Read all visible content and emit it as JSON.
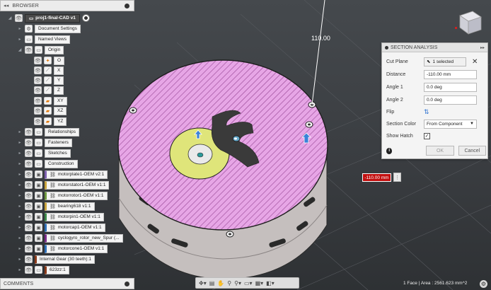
{
  "browser": {
    "title": "BROWSER",
    "collapse_icon": "double-chevron-left-icon",
    "root_label": "proj1-final-CAD v1",
    "items": [
      {
        "label": "Document Settings",
        "icon": "gear-icon"
      },
      {
        "label": "Named Views",
        "icon": "folder-icon"
      },
      {
        "label": "Origin",
        "icon": "folder-icon"
      },
      {
        "label": "O",
        "icon": "origin-point-icon"
      },
      {
        "label": "X",
        "icon": "axis-icon"
      },
      {
        "label": "Y",
        "icon": "axis-icon"
      },
      {
        "label": "Z",
        "icon": "axis-icon"
      },
      {
        "label": "XY",
        "icon": "plane-icon"
      },
      {
        "label": "XZ",
        "icon": "plane-icon"
      },
      {
        "label": "YZ",
        "icon": "plane-icon"
      },
      {
        "label": "Relationships",
        "icon": "folder-icon"
      },
      {
        "label": "Fasteners",
        "icon": "folder-icon"
      },
      {
        "label": "Sketches",
        "icon": "folder-icon"
      },
      {
        "label": "Construction",
        "icon": "folder-icon"
      }
    ],
    "components": [
      {
        "label": "motorplate1-OEM v2:1",
        "color": "#7e5fb0"
      },
      {
        "label": "motorstator1-OEM v1:1",
        "color": "#c9a33a"
      },
      {
        "label": "motorrotor1-OEM v1:1",
        "color": "#6f9a3e"
      },
      {
        "label": "bearing618 v1:1",
        "color": "#c9a33a"
      },
      {
        "label": "motorpin1-OEM v1:1",
        "color": "#3d8a4a"
      },
      {
        "label": "motorcap1-OEM v1:1",
        "color": "#2e6fb8"
      },
      {
        "label": "cyclogyro_rotor_new_Spur (...",
        "color": "#7a2a8a"
      },
      {
        "label": "motorcone1-OEM v1:1",
        "color": "#2e6fb8"
      }
    ],
    "tail_items": [
      {
        "label": "Internal Gear (30 teeth):1",
        "color": "#8a3a1a"
      },
      {
        "label": "623zz:1",
        "color": "#8a3a1a"
      }
    ]
  },
  "comments": {
    "title": "COMMENTS"
  },
  "viewport": {
    "dimension_label": "110.00",
    "distance_input": "-110.00 mm",
    "status_text": "1 Face | Area : 2561.623 mm^2"
  },
  "section_analysis": {
    "title": "SECTION ANALYSIS",
    "rows": {
      "cut_plane_label": "Cut Plane",
      "cut_plane_value": "1 selected",
      "distance_label": "Distance",
      "distance_value": "-110.00 mm",
      "angle1_label": "Angle 1",
      "angle1_value": "0.0 deg",
      "angle2_label": "Angle 2",
      "angle2_value": "0.0 deg",
      "flip_label": "Flip",
      "section_color_label": "Section Color",
      "section_color_value": "From Component",
      "show_hatch_label": "Show Hatch"
    },
    "ok_label": "OK",
    "cancel_label": "Cancel"
  }
}
